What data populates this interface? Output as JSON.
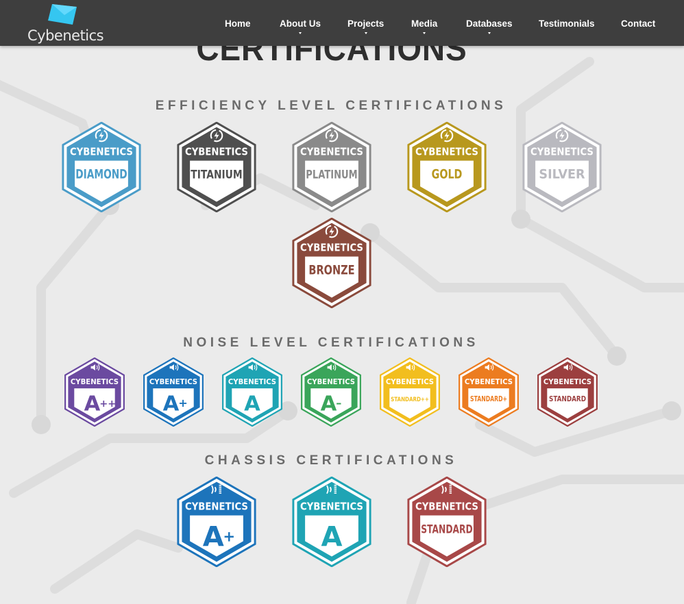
{
  "header": {
    "logo_text": "Cybenetics",
    "nav": [
      {
        "label": "Home",
        "has_dropdown": false
      },
      {
        "label": "About Us",
        "has_dropdown": true
      },
      {
        "label": "Projects",
        "has_dropdown": true
      },
      {
        "label": "Media",
        "has_dropdown": true
      },
      {
        "label": "Databases",
        "has_dropdown": true
      },
      {
        "label": "Testimonials",
        "has_dropdown": false
      },
      {
        "label": "Contact",
        "has_dropdown": false
      }
    ]
  },
  "page_title": "CERTIFICATIONS",
  "sections": {
    "efficiency": {
      "title": "EFFICIENCY LEVEL CERTIFICATIONS",
      "badges": [
        {
          "brand": "CYBENETICS",
          "level": "DIAMOND",
          "color": "#4a9cc8"
        },
        {
          "brand": "CYBENETICS",
          "level": "TITANIUM",
          "color": "#4f4f4f"
        },
        {
          "brand": "CYBENETICS",
          "level": "PLATINUM",
          "color": "#8a8a8a"
        },
        {
          "brand": "CYBENETICS",
          "level": "GOLD",
          "color": "#b8981e"
        },
        {
          "brand": "CYBENETICS",
          "level": "SILVER",
          "color": "#b9b9bf"
        },
        {
          "brand": "CYBENETICS",
          "level": "BRONZE",
          "color": "#8a4a3c"
        }
      ]
    },
    "noise": {
      "title": "NOISE LEVEL CERTIFICATIONS",
      "badges": [
        {
          "brand": "CYBENETICS",
          "level": "A",
          "suffix": "++",
          "color": "#6b4aa0"
        },
        {
          "brand": "CYBENETICS",
          "level": "A",
          "suffix": "+",
          "color": "#1d74bb"
        },
        {
          "brand": "CYBENETICS",
          "level": "A",
          "suffix": "",
          "color": "#1fa4b4"
        },
        {
          "brand": "CYBENETICS",
          "level": "A",
          "suffix": "–",
          "color": "#3aa55a"
        },
        {
          "brand": "CYBENETICS",
          "level": "STANDARD++",
          "suffix": "",
          "color": "#f2be1e"
        },
        {
          "brand": "CYBENETICS",
          "level": "STANDARD+",
          "suffix": "",
          "color": "#ec7c20"
        },
        {
          "brand": "CYBENETICS",
          "level": "STANDARD",
          "suffix": "",
          "color": "#9c3f3f"
        }
      ]
    },
    "chassis": {
      "title": "CHASSIS CERTIFICATIONS",
      "badges": [
        {
          "brand": "CYBENETICS",
          "level": "A",
          "suffix": "+",
          "color": "#1d74bb"
        },
        {
          "brand": "CYBENETICS",
          "level": "A",
          "suffix": "",
          "color": "#1fa4b4"
        },
        {
          "brand": "CYBENETICS",
          "level": "STANDARD",
          "suffix": "",
          "color": "#a84848"
        }
      ]
    }
  }
}
